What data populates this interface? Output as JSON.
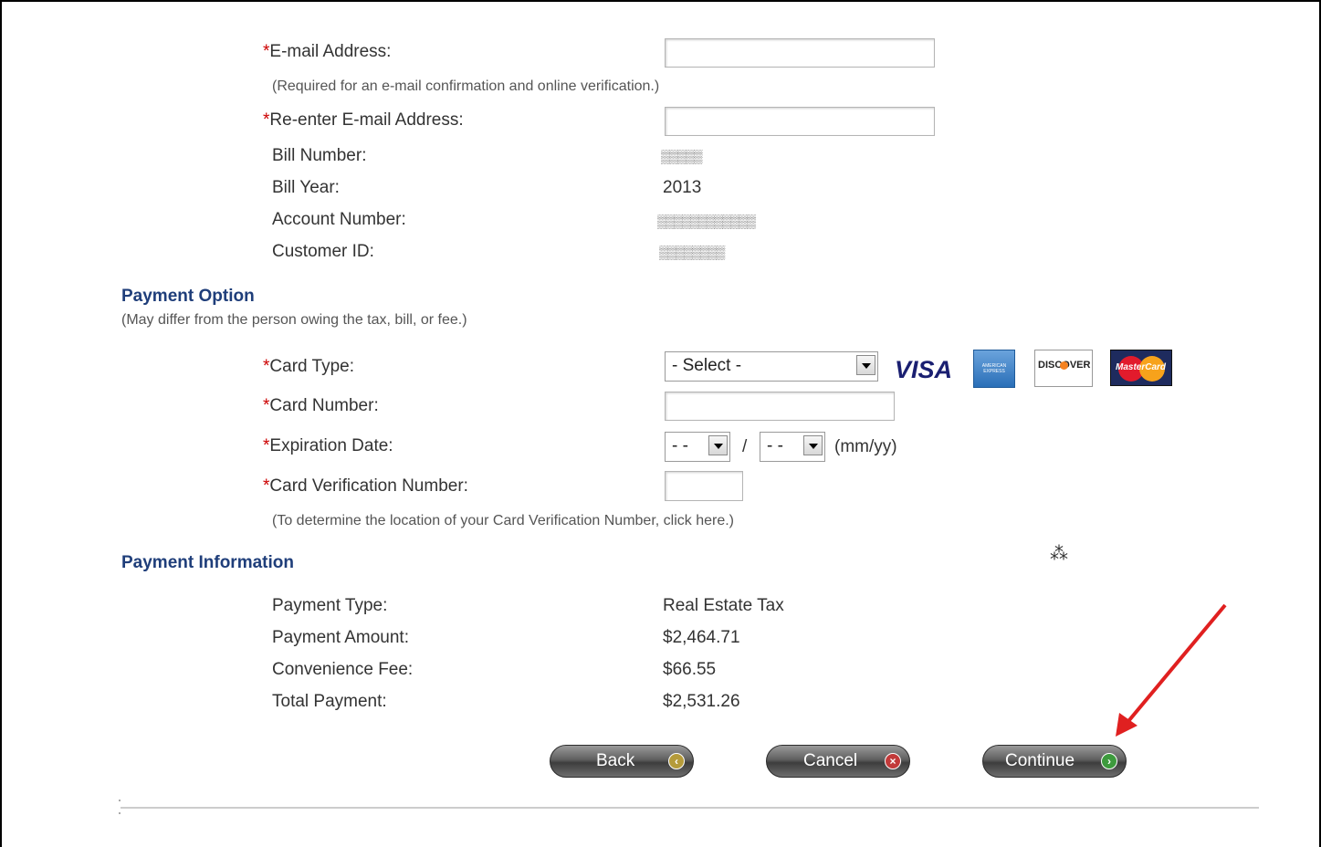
{
  "contact": {
    "email_label": "E-mail Address:",
    "email_value": "",
    "email_note": "(Required for an e-mail confirmation and online verification.)",
    "reenter_label": "Re-enter E-mail Address:",
    "reenter_value": "",
    "required_mark": "*"
  },
  "bill": {
    "bill_number_label": "Bill Number:",
    "bill_number_value": "▒▒▒▒▒",
    "bill_year_label": "Bill Year:",
    "bill_year_value": "2013",
    "account_label": "Account Number:",
    "account_value": "▒▒▒▒▒▒▒▒▒▒▒▒",
    "customer_label": "Customer ID:",
    "customer_value": "▒▒▒▒▒▒▒▒"
  },
  "payment_option": {
    "title": "Payment Option",
    "subtitle": "(May differ from the person owing the tax, bill, or fee.)",
    "card_type_label": "Card Type:",
    "card_type_selected": "- Select -",
    "card_logos": [
      "VISA",
      "AMERICAN EXPRESS",
      "DISCOVER",
      "MasterCard"
    ],
    "card_number_label": "Card Number:",
    "card_number_value": "",
    "expiration_label": "Expiration Date:",
    "exp_month": "- -",
    "exp_separator": "/",
    "exp_year": "- -",
    "exp_format": "(mm/yy)",
    "cvn_label": "Card Verification Number:",
    "cvn_value": "",
    "cvn_note": "(To determine the location of your Card Verification Number, click here.)"
  },
  "payment_info": {
    "title": "Payment Information",
    "type_label": "Payment Type:",
    "type_value": "Real Estate Tax",
    "amount_label": "Payment Amount:",
    "amount_value": "$2,464.71",
    "fee_label": "Convenience Fee:",
    "fee_value": "$66.55",
    "total_label": "Total Payment:",
    "total_value": "$2,531.26"
  },
  "buttons": {
    "back": "Back",
    "cancel": "Cancel",
    "continue": "Continue"
  },
  "colors": {
    "section_heading": "#1f3e7a",
    "required": "#cc0000",
    "annotation_arrow": "#e02020"
  },
  "icons": {
    "back": "back-arrow-icon",
    "cancel": "close-x-icon",
    "continue": "forward-arrow-icon",
    "cursor": "busy-cursor-icon"
  }
}
